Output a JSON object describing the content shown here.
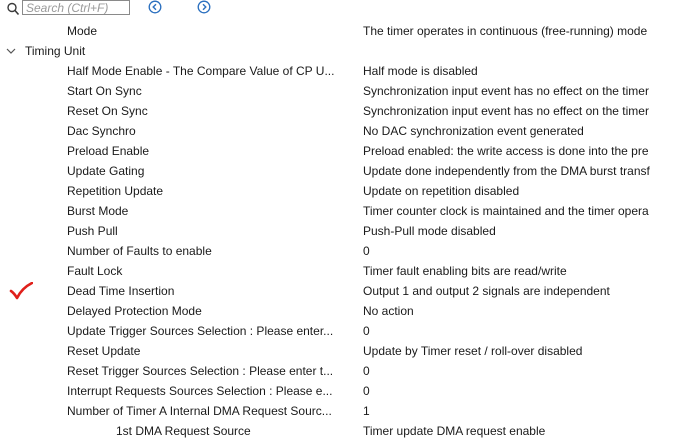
{
  "toolbar": {
    "search_placeholder": "Search (Ctrl+F)",
    "prev_icon": "arrow-left-circle-icon",
    "next_icon": "arrow-right-circle-icon",
    "accent_color": "#2a6fbf"
  },
  "rows": [
    {
      "label": "Mode",
      "value": "The timer operates in continuous (free-running) mode"
    },
    {
      "label": "Timing Unit",
      "value": ""
    },
    {
      "label": "Half Mode Enable - The Compare Value of CP U...",
      "value": "Half mode is disabled"
    },
    {
      "label": "Start On Sync",
      "value": "Synchronization input event has no effect on the timer"
    },
    {
      "label": "Reset On Sync",
      "value": "Synchronization input event has no effect on the timer"
    },
    {
      "label": "Dac Synchro",
      "value": "No DAC synchronization event generated"
    },
    {
      "label": "Preload Enable",
      "value": "Preload enabled: the write access is done into the pre"
    },
    {
      "label": "Update Gating",
      "value": "Update done independently from the DMA burst transf"
    },
    {
      "label": "Repetition Update",
      "value": "Update on repetition disabled"
    },
    {
      "label": "Burst Mode",
      "value": "Timer counter clock is maintained and the timer opera"
    },
    {
      "label": "Push Pull",
      "value": "Push-Pull mode disabled"
    },
    {
      "label": "Number of Faults to enable",
      "value": "0"
    },
    {
      "label": "Fault Lock",
      "value": "Timer fault enabling bits are read/write"
    },
    {
      "label": "Dead Time Insertion",
      "value": "Output 1 and output 2 signals are independent"
    },
    {
      "label": "Delayed Protection Mode",
      "value": "No action"
    },
    {
      "label": "Update Trigger Sources Selection : Please enter...",
      "value": "0"
    },
    {
      "label": "Reset Update",
      "value": "Update by Timer reset / roll-over disabled"
    },
    {
      "label": "Reset Trigger Sources Selection : Please enter t...",
      "value": "0"
    },
    {
      "label": "Interrupt Requests Sources Selection : Please e...",
      "value": "0"
    },
    {
      "label": "Number of Timer A Internal DMA Request Sourc...",
      "value": "1"
    },
    {
      "label": "1st DMA Request Source",
      "value": "Timer update DMA request enable"
    }
  ],
  "annotation": {
    "icon": "red-checkmark-icon",
    "color": "#e0201b"
  }
}
